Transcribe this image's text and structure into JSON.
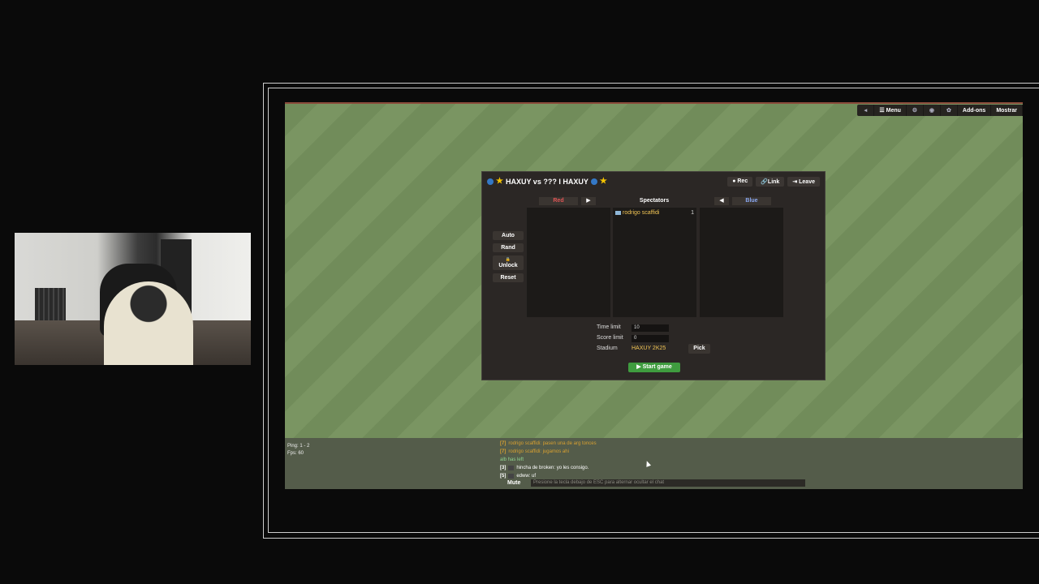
{
  "topbar": {
    "menu": "☰ Menu",
    "addons": "Add-ons",
    "show": "Mostrar"
  },
  "room": {
    "title": "HAXUY vs ??? I HAXUY",
    "rec": "● Rec",
    "link": "🔗Link",
    "leave": "⇥ Leave"
  },
  "teams": {
    "red": "Red",
    "spectators": "Spectators",
    "blue": "Blue",
    "move_right": "▶",
    "move_left": "◀",
    "spectator_list": [
      {
        "name": "rodrigo scaffidi",
        "ping": "1"
      }
    ]
  },
  "side_buttons": {
    "auto": "Auto",
    "rand": "Rand",
    "lock_icon": "🔒",
    "unlock": "Unlock",
    "reset": "Reset"
  },
  "settings": {
    "time_limit_label": "Time limit",
    "time_limit_value": "10",
    "score_limit_label": "Score limit",
    "score_limit_value": "0",
    "stadium_label": "Stadium",
    "stadium_value": "HAXUY 2K25",
    "pick": "Pick",
    "start": "▶ Start game"
  },
  "stats": {
    "ping": "Ping: 1 - 2",
    "fps": "Fps: 60"
  },
  "chat": {
    "messages": [
      {
        "num": "[7]",
        "text": "rodrigo scaffidi: pasen una de arg tonces",
        "color": "#d8a030"
      },
      {
        "num": "[7]",
        "text": "rodrigo scaffidi: jugamos ahi",
        "color": "#d8a030"
      },
      {
        "num": "",
        "text": "alb has left",
        "color": "#8fd28f"
      },
      {
        "num": "[3]",
        "text": "hincha de broken: yo les consigo.",
        "color": "#ffffff"
      },
      {
        "num": "[5]",
        "text": "edww: uf",
        "color": "#ffffff"
      }
    ],
    "mute": "Mute",
    "placeholder": "Presione la tecla debajo de ESC para alternar ocultar el chat"
  },
  "colors": {
    "red_team": "#e05555",
    "blue_team": "#8aa8f0",
    "start_button": "#3f9c3f",
    "stadium_text": "#f0c454"
  }
}
